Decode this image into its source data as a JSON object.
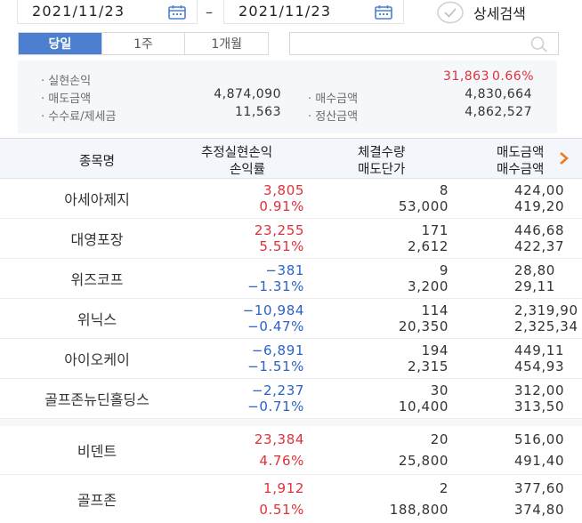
{
  "date_range": {
    "start": "2021/11/23",
    "separator": "–",
    "end": "2021/11/23"
  },
  "detail_search": {
    "label": "상세검색"
  },
  "period_tabs": [
    {
      "label": "당일",
      "active": true
    },
    {
      "label": "1주",
      "active": false
    },
    {
      "label": "1개월",
      "active": false
    }
  ],
  "search": {
    "value": "",
    "placeholder": ""
  },
  "summary": {
    "realized_pl_label": "실현손익",
    "realized_pl_value": "31,863",
    "realized_pl_rate": "0.66%",
    "sell_amount_label": "매도금액",
    "sell_amount_value": "4,874,090",
    "buy_amount_label": "매수금액",
    "buy_amount_value": "4,830,664",
    "fee_tax_label": "수수료/제세금",
    "fee_tax_value": "11,563",
    "settlement_label": "정산금액",
    "settlement_value": "4,862,527"
  },
  "table": {
    "headers": {
      "name": "종목명",
      "pl_top": "추정실현손익",
      "pl_bottom": "손익률",
      "qty_top": "체결수량",
      "qty_bottom": "매도단가",
      "amt_top": "매도금액",
      "amt_bottom": "매수금액"
    },
    "rows": [
      {
        "name": "아세아제지",
        "pl": "3,805",
        "rate": "0.91%",
        "qty": "8",
        "price": "53,000",
        "sell": "424,00",
        "buy": "419,20",
        "sign": "pos"
      },
      {
        "name": "대영포장",
        "pl": "23,255",
        "rate": "5.51%",
        "qty": "171",
        "price": "2,612",
        "sell": "446,68",
        "buy": "422,37",
        "sign": "pos"
      },
      {
        "name": "위즈코프",
        "pl": "−381",
        "rate": "−1.31%",
        "qty": "9",
        "price": "3,200",
        "sell": "28,80",
        "buy": "29,11",
        "sign": "neg"
      },
      {
        "name": "위닉스",
        "pl": "−10,984",
        "rate": "−0.47%",
        "qty": "114",
        "price": "20,350",
        "sell": "2,319,90",
        "buy": "2,325,34",
        "sign": "neg"
      },
      {
        "name": "아이오케이",
        "pl": "−6,891",
        "rate": "−1.51%",
        "qty": "194",
        "price": "2,315",
        "sell": "449,11",
        "buy": "454,93",
        "sign": "neg"
      },
      {
        "name": "골프존뉴딘홀딩스",
        "pl": "−2,237",
        "rate": "−0.71%",
        "qty": "30",
        "price": "10,400",
        "sell": "312,00",
        "buy": "313,50",
        "sign": "neg"
      },
      {
        "name": "비덴트",
        "pl": "23,384",
        "rate": "4.76%",
        "qty": "20",
        "price": "25,800",
        "sell": "516,00",
        "buy": "491,40",
        "sign": "pos"
      },
      {
        "name": "골프존",
        "pl": "1,912",
        "rate": "0.51%",
        "qty": "2",
        "price": "188,800",
        "sell": "377,60",
        "buy": "374,80",
        "sign": "pos"
      }
    ]
  },
  "colors": {
    "accent": "#4c7fcf",
    "positive": "#e0303a",
    "negative": "#2a62c9",
    "chevron": "#f07a1a"
  }
}
